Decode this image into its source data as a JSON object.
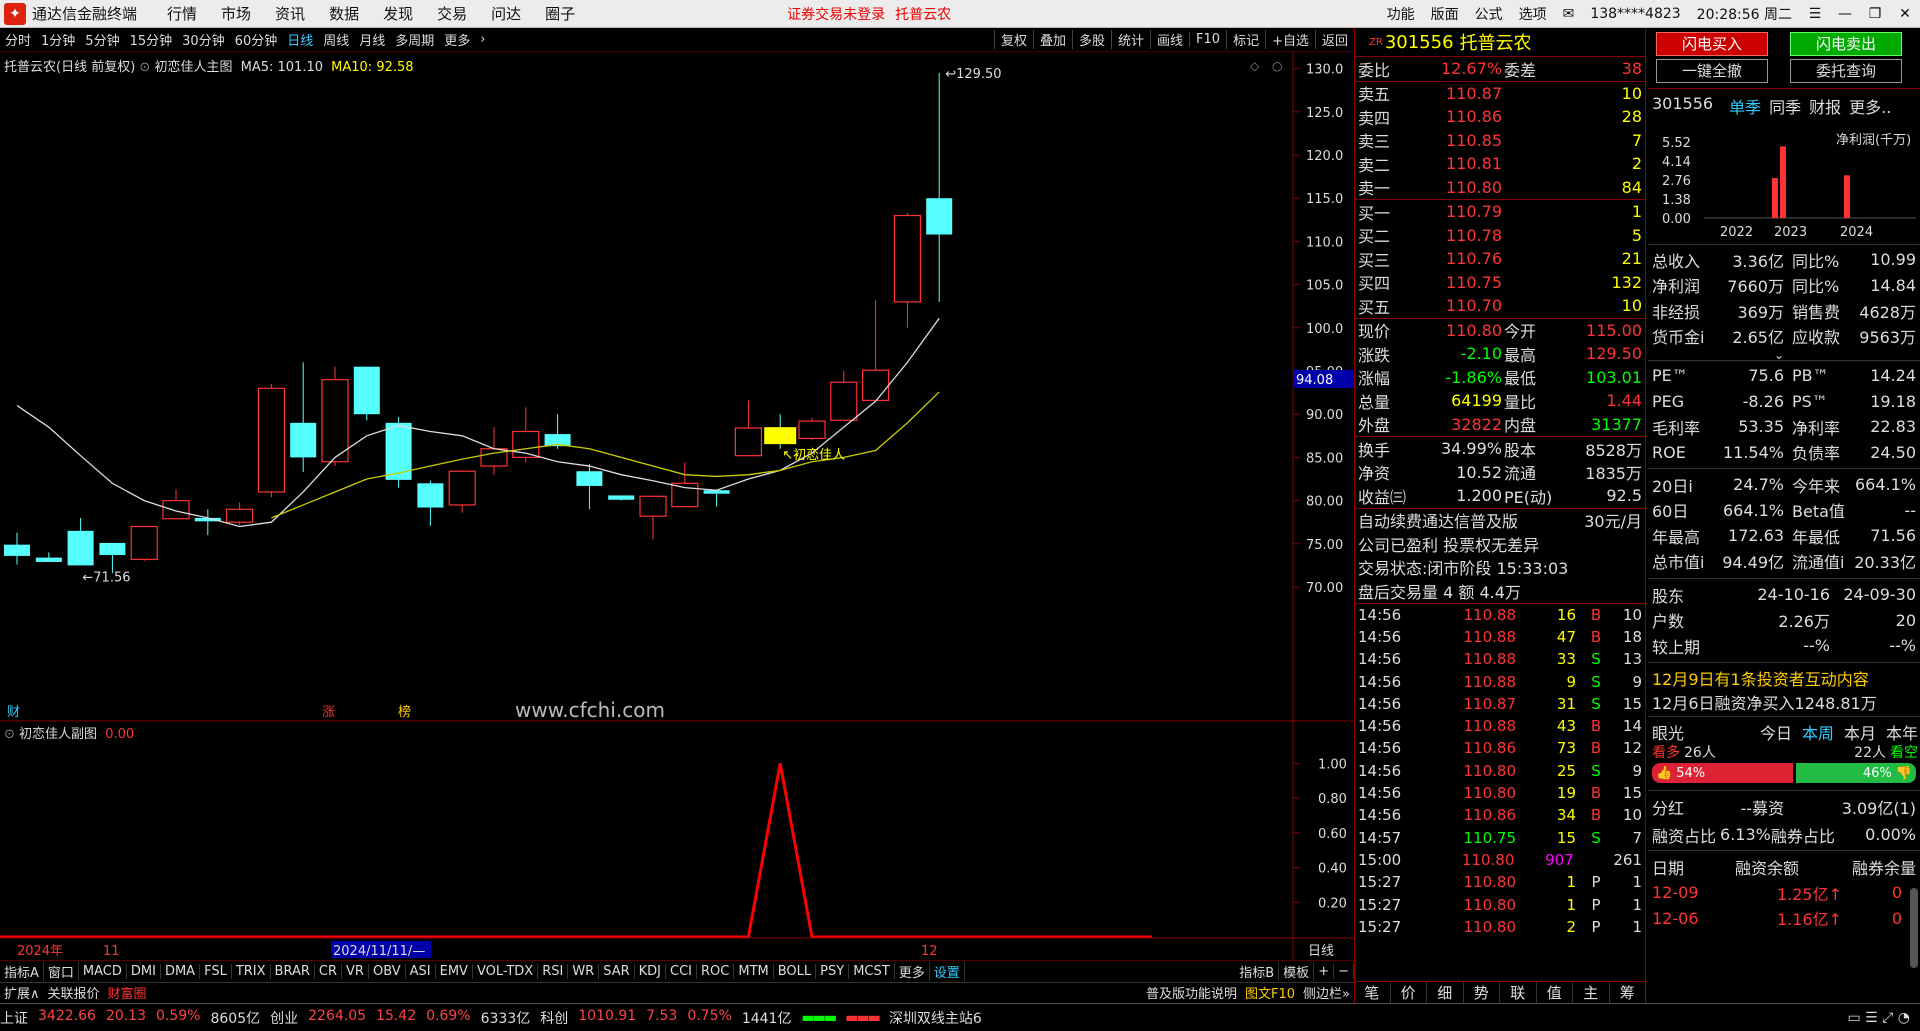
{
  "app": {
    "name": "通达信金融终端",
    "menu": [
      "行情",
      "市场",
      "资讯",
      "数据",
      "发现",
      "交易",
      "问达",
      "圈子"
    ],
    "notice": "证券交易未登录",
    "stock_title": "托普云农",
    "right_menu": [
      "功能",
      "版面",
      "公式",
      "选项"
    ],
    "account": "138****4823",
    "clock": "20:28:56 周二"
  },
  "toolbar": {
    "periods": [
      "分时",
      "1分钟",
      "5分钟",
      "15分钟",
      "30分钟",
      "60分钟",
      "日线",
      "周线",
      "月线",
      "多周期",
      "更多"
    ],
    "active_period": "日线",
    "right_buttons": [
      "复权",
      "叠加",
      "多股",
      "统计",
      "画线",
      "F10",
      "标记",
      "+自选",
      "返回"
    ]
  },
  "chart_info": {
    "name": "托普云农(日线 前复权)",
    "formula": "初恋佳人主图",
    "ma5_label": "MA5: 101.10",
    "ma10_label": "MA10: 92.58"
  },
  "chart_data": {
    "type": "candlestick",
    "ylim": [
      70,
      131
    ],
    "y_ticks": [
      "130.0",
      "125.0",
      "120.0",
      "115.0",
      "110.0",
      "105.0",
      "100.0",
      "95.00",
      "90.00",
      "85.00",
      "80.00",
      "75.00",
      "70.00"
    ],
    "y_tick_values": [
      130,
      125,
      120,
      115,
      110,
      105,
      100,
      95,
      90,
      85,
      80,
      75,
      70
    ],
    "current_price_marker": "94.08",
    "current_price_marker_value": 94.08,
    "high_label": "129.50",
    "low_label": "71.56",
    "signal_label": "初恋佳人",
    "candles": [
      {
        "o": 74.9,
        "c": 73.6,
        "h": 76.3,
        "l": 72.6
      },
      {
        "o": 73.4,
        "c": 72.9,
        "h": 74.0,
        "l": 72.9
      },
      {
        "o": 76.5,
        "c": 72.5,
        "h": 78.0,
        "l": 72.5
      },
      {
        "o": 75.1,
        "c": 73.7,
        "h": 75.1,
        "l": 71.6
      },
      {
        "o": 73.2,
        "c": 77.0,
        "h": 77.0,
        "l": 73.0
      },
      {
        "o": 77.9,
        "c": 80.0,
        "h": 81.3,
        "l": 77.9
      },
      {
        "o": 78.0,
        "c": 77.6,
        "h": 79.0,
        "l": 76.0
      },
      {
        "o": 77.5,
        "c": 79.0,
        "h": 79.8,
        "l": 77.2
      },
      {
        "o": 81.0,
        "c": 93.0,
        "h": 93.5,
        "l": 80.4
      },
      {
        "o": 89.0,
        "c": 85.0,
        "h": 96.0,
        "l": 83.3
      },
      {
        "o": 84.5,
        "c": 94.0,
        "h": 95.5,
        "l": 84.0
      },
      {
        "o": 95.5,
        "c": 90.0,
        "h": 95.5,
        "l": 89.3
      },
      {
        "o": 89.0,
        "c": 82.4,
        "h": 89.7,
        "l": 81.5
      },
      {
        "o": 82.0,
        "c": 79.2,
        "h": 82.3,
        "l": 77.1
      },
      {
        "o": 79.5,
        "c": 83.4,
        "h": 83.5,
        "l": 78.6
      },
      {
        "o": 84.0,
        "c": 86.0,
        "h": 88.5,
        "l": 83.0
      },
      {
        "o": 85.0,
        "c": 88.0,
        "h": 90.8,
        "l": 84.4
      },
      {
        "o": 87.7,
        "c": 86.3,
        "h": 90.0,
        "l": 86.0
      },
      {
        "o": 83.4,
        "c": 81.7,
        "h": 84.2,
        "l": 79.0
      },
      {
        "o": 80.6,
        "c": 80.1,
        "h": 80.6,
        "l": 80.0
      },
      {
        "o": 78.2,
        "c": 80.5,
        "h": 80.5,
        "l": 75.5
      },
      {
        "o": 79.3,
        "c": 82.0,
        "h": 84.4,
        "l": 79.3
      },
      {
        "o": 81.2,
        "c": 80.8,
        "h": 81.2,
        "l": 79.3
      },
      {
        "o": 85.2,
        "c": 88.4,
        "h": 91.6,
        "l": 85.2
      },
      {
        "o": 88.2,
        "c": 86.8,
        "h": 90.0,
        "l": 86.0
      },
      {
        "o": 87.2,
        "c": 89.2,
        "h": 89.6,
        "l": 87.0
      },
      {
        "o": 89.3,
        "c": 93.7,
        "h": 95.0,
        "l": 89.3
      },
      {
        "o": 91.6,
        "c": 95.1,
        "h": 103.2,
        "l": 91.6
      },
      {
        "o": 103.0,
        "c": 113.0,
        "h": 113.3,
        "l": 100.0
      },
      {
        "o": 115.0,
        "c": 110.8,
        "h": 129.5,
        "l": 103.0
      }
    ],
    "ma5": [
      91.0,
      88.5,
      85.2,
      82.0,
      80.0,
      78.8,
      78.0,
      77.0,
      77.5,
      81.0,
      85.0,
      87.5,
      88.7,
      88.0,
      87.5,
      86.0,
      85.5,
      84.5,
      84.0,
      83.0,
      82.3,
      81.5,
      81.2,
      82.5,
      83.5,
      85.5,
      88.5,
      91.5,
      96.0,
      101.1
    ],
    "ma10": [
      null,
      null,
      null,
      null,
      null,
      null,
      null,
      null,
      78.0,
      79.5,
      81.0,
      82.5,
      83.2,
      84.0,
      84.8,
      85.5,
      86.0,
      86.5,
      86.0,
      85.0,
      84.0,
      83.0,
      82.8,
      83.0,
      83.5,
      84.5,
      85.0,
      85.8,
      89.0,
      92.58
    ],
    "x_labels": [
      "2024年",
      "11",
      "2024/11/11/—",
      "12",
      "日线"
    ],
    "indicators": [
      "财",
      "涨",
      "榜"
    ],
    "watermark": "www.cfchi.com",
    "sub": {
      "name": "初恋佳人副图",
      "value": "0.00",
      "ylim": [
        0,
        1.1
      ],
      "y_ticks": [
        "1.00",
        "0.80",
        "0.60",
        "0.40",
        "0.20"
      ],
      "y_tick_values": [
        1.0,
        0.8,
        0.6,
        0.4,
        0.2
      ],
      "values": [
        0,
        0,
        0,
        0,
        0,
        0,
        0,
        0,
        0,
        0,
        0,
        0,
        0,
        0,
        0,
        0,
        0,
        0,
        0,
        0,
        0,
        0,
        0,
        0,
        1,
        0,
        0,
        0,
        0,
        0
      ]
    }
  },
  "indicator_tabs": [
    "指标A",
    "窗口",
    "MACD",
    "DMI",
    "DMA",
    "FSL",
    "TRIX",
    "BRAR",
    "CR",
    "VR",
    "OBV",
    "ASI",
    "EMV",
    "VOL-TDX",
    "RSI",
    "WR",
    "SAR",
    "KDJ",
    "CCI",
    "ROC",
    "MTM",
    "BOLL",
    "PSY",
    "MCST",
    "更多",
    "设置"
  ],
  "indicator_tabs_right": [
    "指标B",
    "模板"
  ],
  "ext_bar": {
    "left": [
      "扩展∧",
      "关联报价",
      "财富圈"
    ],
    "right": [
      "普及版功能说明",
      "图文F10",
      "侧边栏»"
    ]
  },
  "quote": {
    "code": "301556",
    "name": "托普云农",
    "weibi_label": "委比",
    "weibi": "12.67%",
    "weicha_label": "委差",
    "weicha": "38",
    "asks": [
      {
        "label": "卖五",
        "price": "110.87",
        "vol": "10"
      },
      {
        "label": "卖四",
        "price": "110.86",
        "vol": "28"
      },
      {
        "label": "卖三",
        "price": "110.85",
        "vol": "7"
      },
      {
        "label": "卖二",
        "price": "110.81",
        "vol": "2"
      },
      {
        "label": "卖一",
        "price": "110.80",
        "vol": "84"
      }
    ],
    "bids": [
      {
        "label": "买一",
        "price": "110.79",
        "vol": "1"
      },
      {
        "label": "买二",
        "price": "110.78",
        "vol": "5"
      },
      {
        "label": "买三",
        "price": "110.76",
        "vol": "21"
      },
      {
        "label": "买四",
        "price": "110.75",
        "vol": "132"
      },
      {
        "label": "买五",
        "price": "110.70",
        "vol": "10"
      }
    ],
    "stats": [
      {
        "k": "现价",
        "v": "110.80",
        "k2": "今开",
        "v2": "115.00",
        "c": "r",
        "c2": "r"
      },
      {
        "k": "涨跌",
        "v": "-2.10",
        "k2": "最高",
        "v2": "129.50",
        "c": "g",
        "c2": "r"
      },
      {
        "k": "涨幅",
        "v": "-1.86%",
        "k2": "最低",
        "v2": "103.01",
        "c": "g",
        "c2": "g"
      },
      {
        "k": "总量",
        "v": "64199",
        "k2": "量比",
        "v2": "1.44",
        "c": "y",
        "c2": "r"
      },
      {
        "k": "外盘",
        "v": "32822",
        "k2": "内盘",
        "v2": "31377",
        "c": "r",
        "c2": "g"
      }
    ],
    "stats2": [
      {
        "k": "换手",
        "v": "34.99%",
        "k2": "股本",
        "v2": "8528万"
      },
      {
        "k": "净资",
        "v": "10.52",
        "k2": "流通",
        "v2": "1835万"
      },
      {
        "k": "收益㈢",
        "v": "1.200",
        "k2": "PE(动)",
        "v2": "92.5"
      }
    ],
    "info1": "自动续费通达信普及版",
    "info1_price": "30元/月",
    "info2": "公司已盈利 投票权无差异",
    "trade_status_label": "交易状态:",
    "trade_status": "闭市阶段 15:33:03",
    "after_hours": "盘后交易量 4 额 4.4万",
    "ticks": [
      {
        "t": "14:56",
        "p": "110.88",
        "v": "16",
        "s": "B",
        "n": "10"
      },
      {
        "t": "14:56",
        "p": "110.88",
        "v": "47",
        "s": "B",
        "n": "18"
      },
      {
        "t": "14:56",
        "p": "110.88",
        "v": "33",
        "s": "S",
        "n": "13"
      },
      {
        "t": "14:56",
        "p": "110.88",
        "v": "9",
        "s": "S",
        "n": "9"
      },
      {
        "t": "14:56",
        "p": "110.87",
        "v": "31",
        "s": "S",
        "n": "15"
      },
      {
        "t": "14:56",
        "p": "110.88",
        "v": "43",
        "s": "B",
        "n": "14"
      },
      {
        "t": "14:56",
        "p": "110.86",
        "v": "73",
        "s": "B",
        "n": "12"
      },
      {
        "t": "14:56",
        "p": "110.80",
        "v": "25",
        "s": "S",
        "n": "9"
      },
      {
        "t": "14:56",
        "p": "110.80",
        "v": "19",
        "s": "B",
        "n": "15"
      },
      {
        "t": "14:56",
        "p": "110.86",
        "v": "34",
        "s": "B",
        "n": "10"
      },
      {
        "t": "14:57",
        "p": "110.75",
        "v": "15",
        "s": "S",
        "n": "7"
      },
      {
        "t": "15:00",
        "p": "110.80",
        "v": "907",
        "s": "",
        "n": "261"
      },
      {
        "t": "15:27",
        "p": "110.80",
        "v": "1",
        "s": "P",
        "n": "1"
      },
      {
        "t": "15:27",
        "p": "110.80",
        "v": "1",
        "s": "P",
        "n": "1"
      },
      {
        "t": "15:27",
        "p": "110.80",
        "v": "2",
        "s": "P",
        "n": "1"
      }
    ],
    "bottom_tabs": [
      "笔",
      "价",
      "细",
      "势",
      "联",
      "值",
      "主",
      "筹"
    ]
  },
  "side": {
    "buttons": [
      "闪电买入",
      "闪电卖出",
      "一键全撤",
      "委托查询"
    ],
    "code": "301556",
    "tabs": [
      "单季",
      "同季",
      "财报",
      "更多.."
    ],
    "mini_chart": {
      "title": "净利润(千万)",
      "y_ticks": [
        "5.52",
        "4.14",
        "2.76",
        "1.38",
        "0.00"
      ],
      "x_ticks": [
        "2022",
        "2023",
        "2024"
      ],
      "bars": [
        2.9,
        5.2,
        3.1
      ]
    },
    "fin": [
      {
        "k": "总收入",
        "v": "3.36亿",
        "k2": "同比%",
        "v2": "10.99"
      },
      {
        "k": "净利润",
        "v": "7660万",
        "k2": "同比%",
        "v2": "14.84"
      },
      {
        "k": "非经损",
        "v": "369万",
        "k2": "销售费",
        "v2": "4628万"
      },
      {
        "k": "货币金i",
        "v": "2.65亿",
        "k2": "应收款",
        "v2": "9563万"
      }
    ],
    "val": [
      {
        "k": "PE™",
        "v": "75.6",
        "k2": "PB™",
        "v2": "14.24"
      },
      {
        "k": "PEG",
        "v": "-8.26",
        "k2": "PS™",
        "v2": "19.18"
      },
      {
        "k": "毛利率",
        "v": "53.35",
        "k2": "净利率",
        "v2": "22.83"
      },
      {
        "k": "ROE",
        "v": "11.54%",
        "k2": "负债率",
        "v2": "24.50"
      }
    ],
    "perf": [
      {
        "k": "20日i",
        "v": "24.7%",
        "k2": "今年来",
        "v2": "664.1%"
      },
      {
        "k": "60日",
        "v": "664.1%",
        "k2": "Beta值",
        "v2": "--"
      },
      {
        "k": "年最高",
        "v": "172.63",
        "k2": "年最低",
        "v2": "71.56"
      },
      {
        "k": "总市值i",
        "v": "94.49亿",
        "k2": "流通值i",
        "v2": "20.33亿"
      }
    ],
    "holders": [
      {
        "k": "股东",
        "v": "24-10-16",
        "v2": "24-09-30"
      },
      {
        "k": "户数",
        "v": "2.26万",
        "v2": "20"
      },
      {
        "k": "较上期",
        "v": "--%",
        "v2": "--%"
      }
    ],
    "news1": "12月9日有1条投资者互动内容",
    "news2": "12月6日融资净买入1248.81万",
    "eye_label": "眼光",
    "eye_tabs": [
      "今日",
      "本周",
      "本月",
      "本年"
    ],
    "bull_label": "看多",
    "bull_count": "26人",
    "bear_count": "22人",
    "bear_label": "看空",
    "bull_pct": "54%",
    "bear_pct": "46%",
    "bull_value": 54,
    "div_k": "分红",
    "div_v": "--募资",
    "raise": "3.09亿(1)",
    "margin_k": "融资占比",
    "margin_v": "6.13%",
    "short_k": "融券占比",
    "short_v": "0.00%",
    "margin_head": [
      "日期",
      "融资余额",
      "融券余量"
    ],
    "margin_rows": [
      {
        "d": "12-09",
        "a": "1.25亿↑",
        "b": "0"
      },
      {
        "d": "12-06",
        "a": "1.16亿↑",
        "b": "0"
      }
    ]
  },
  "status": {
    "items": [
      {
        "n": "上证",
        "v": "3422.66",
        "c": "20.13",
        "p": "0.59%",
        "a": "8605亿"
      },
      {
        "n": "创业",
        "v": "2264.05",
        "c": "15.42",
        "p": "0.69%",
        "a": "6333亿"
      },
      {
        "n": "科创",
        "v": "1010.91",
        "c": "7.53",
        "p": "0.75%",
        "a": "1441亿"
      }
    ],
    "server": "深圳双线主站6"
  }
}
